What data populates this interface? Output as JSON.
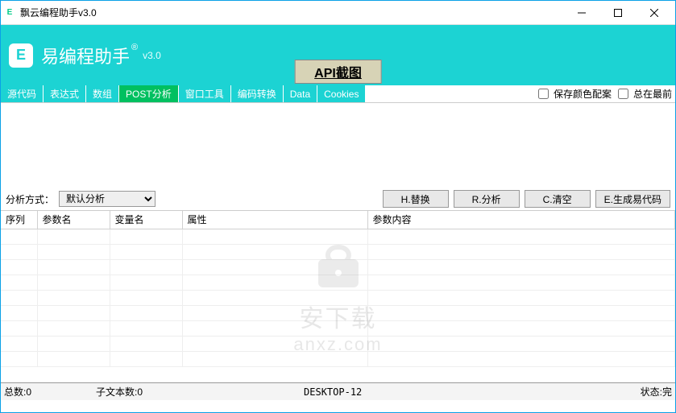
{
  "window": {
    "title": "飘云编程助手v3.0",
    "icon_letter": "E"
  },
  "header": {
    "logo_letter": "E",
    "logo_text": "易编程助手",
    "logo_reg": "®",
    "version": "v3.0",
    "api_button": "API截图"
  },
  "tabs": [
    "源代码",
    "表达式",
    "数组",
    "POST分析",
    "窗口工具",
    "编码转换",
    "Data",
    "Cookies"
  ],
  "active_tab_index": 3,
  "checkboxes": {
    "keep_color": "保存颜色配案",
    "always_top": "总在最前"
  },
  "controls": {
    "method_label": "分析方式：",
    "method_value": "默认分析",
    "btn_replace": "H.替换",
    "btn_analyze": "R.分析",
    "btn_clear": "C.清空",
    "btn_generate": "E.生成易代码"
  },
  "table": {
    "columns": [
      "序列",
      "参数名",
      "变量名",
      "属性",
      "参数内容"
    ],
    "col_widths": [
      "45px",
      "90px",
      "90px",
      "230px",
      "auto"
    ]
  },
  "status": {
    "total": "总数:0",
    "subtext": "子文本数:0",
    "desktop": "DESKTOP-12",
    "state": "状态:完"
  },
  "watermark": {
    "brand": "安下载",
    "url": "anxz.com"
  }
}
